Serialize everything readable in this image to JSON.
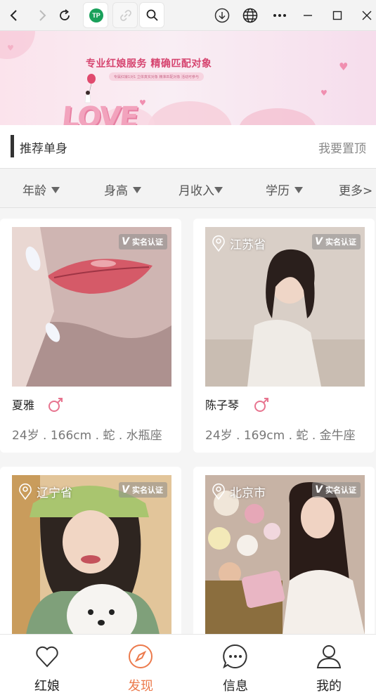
{
  "browser": {
    "tp_badge": "TP"
  },
  "banner": {
    "title": "专业红娘服务  精确匹配对象",
    "subtitle": "专属红娘1对1   立体真实对象   精准匹配对象   活动可参与",
    "logo_word": "LOVE"
  },
  "recommend": {
    "title": "推荐单身",
    "top_action": "我要置顶"
  },
  "filters": {
    "age": "年龄",
    "height": "身高",
    "income": "月收入",
    "education": "学历",
    "more": "更多>"
  },
  "cards": [
    {
      "location": "",
      "verified": "实名认证",
      "name": "夏雅",
      "info": "24岁 . 166cm . 蛇 . 水瓶座"
    },
    {
      "location": "江苏省",
      "verified": "实名认证",
      "name": "陈子琴",
      "info": "24岁 . 169cm . 蛇 . 金牛座"
    },
    {
      "location": "辽宁省",
      "verified": "实名认证",
      "name": "",
      "info": ""
    },
    {
      "location": "北京市",
      "verified": "实名认证",
      "name": "",
      "info": ""
    }
  ],
  "tabs": [
    {
      "label": "红娘",
      "icon": "heart-icon",
      "active": false
    },
    {
      "label": "发现",
      "icon": "compass-icon",
      "active": true
    },
    {
      "label": "信息",
      "icon": "chat-bubble-icon",
      "active": false
    },
    {
      "label": "我的",
      "icon": "person-icon",
      "active": false
    }
  ],
  "colors": {
    "accent": "#ec7a4c",
    "gender_icon": "#e7748f",
    "progress_dot": "#1677ff"
  }
}
